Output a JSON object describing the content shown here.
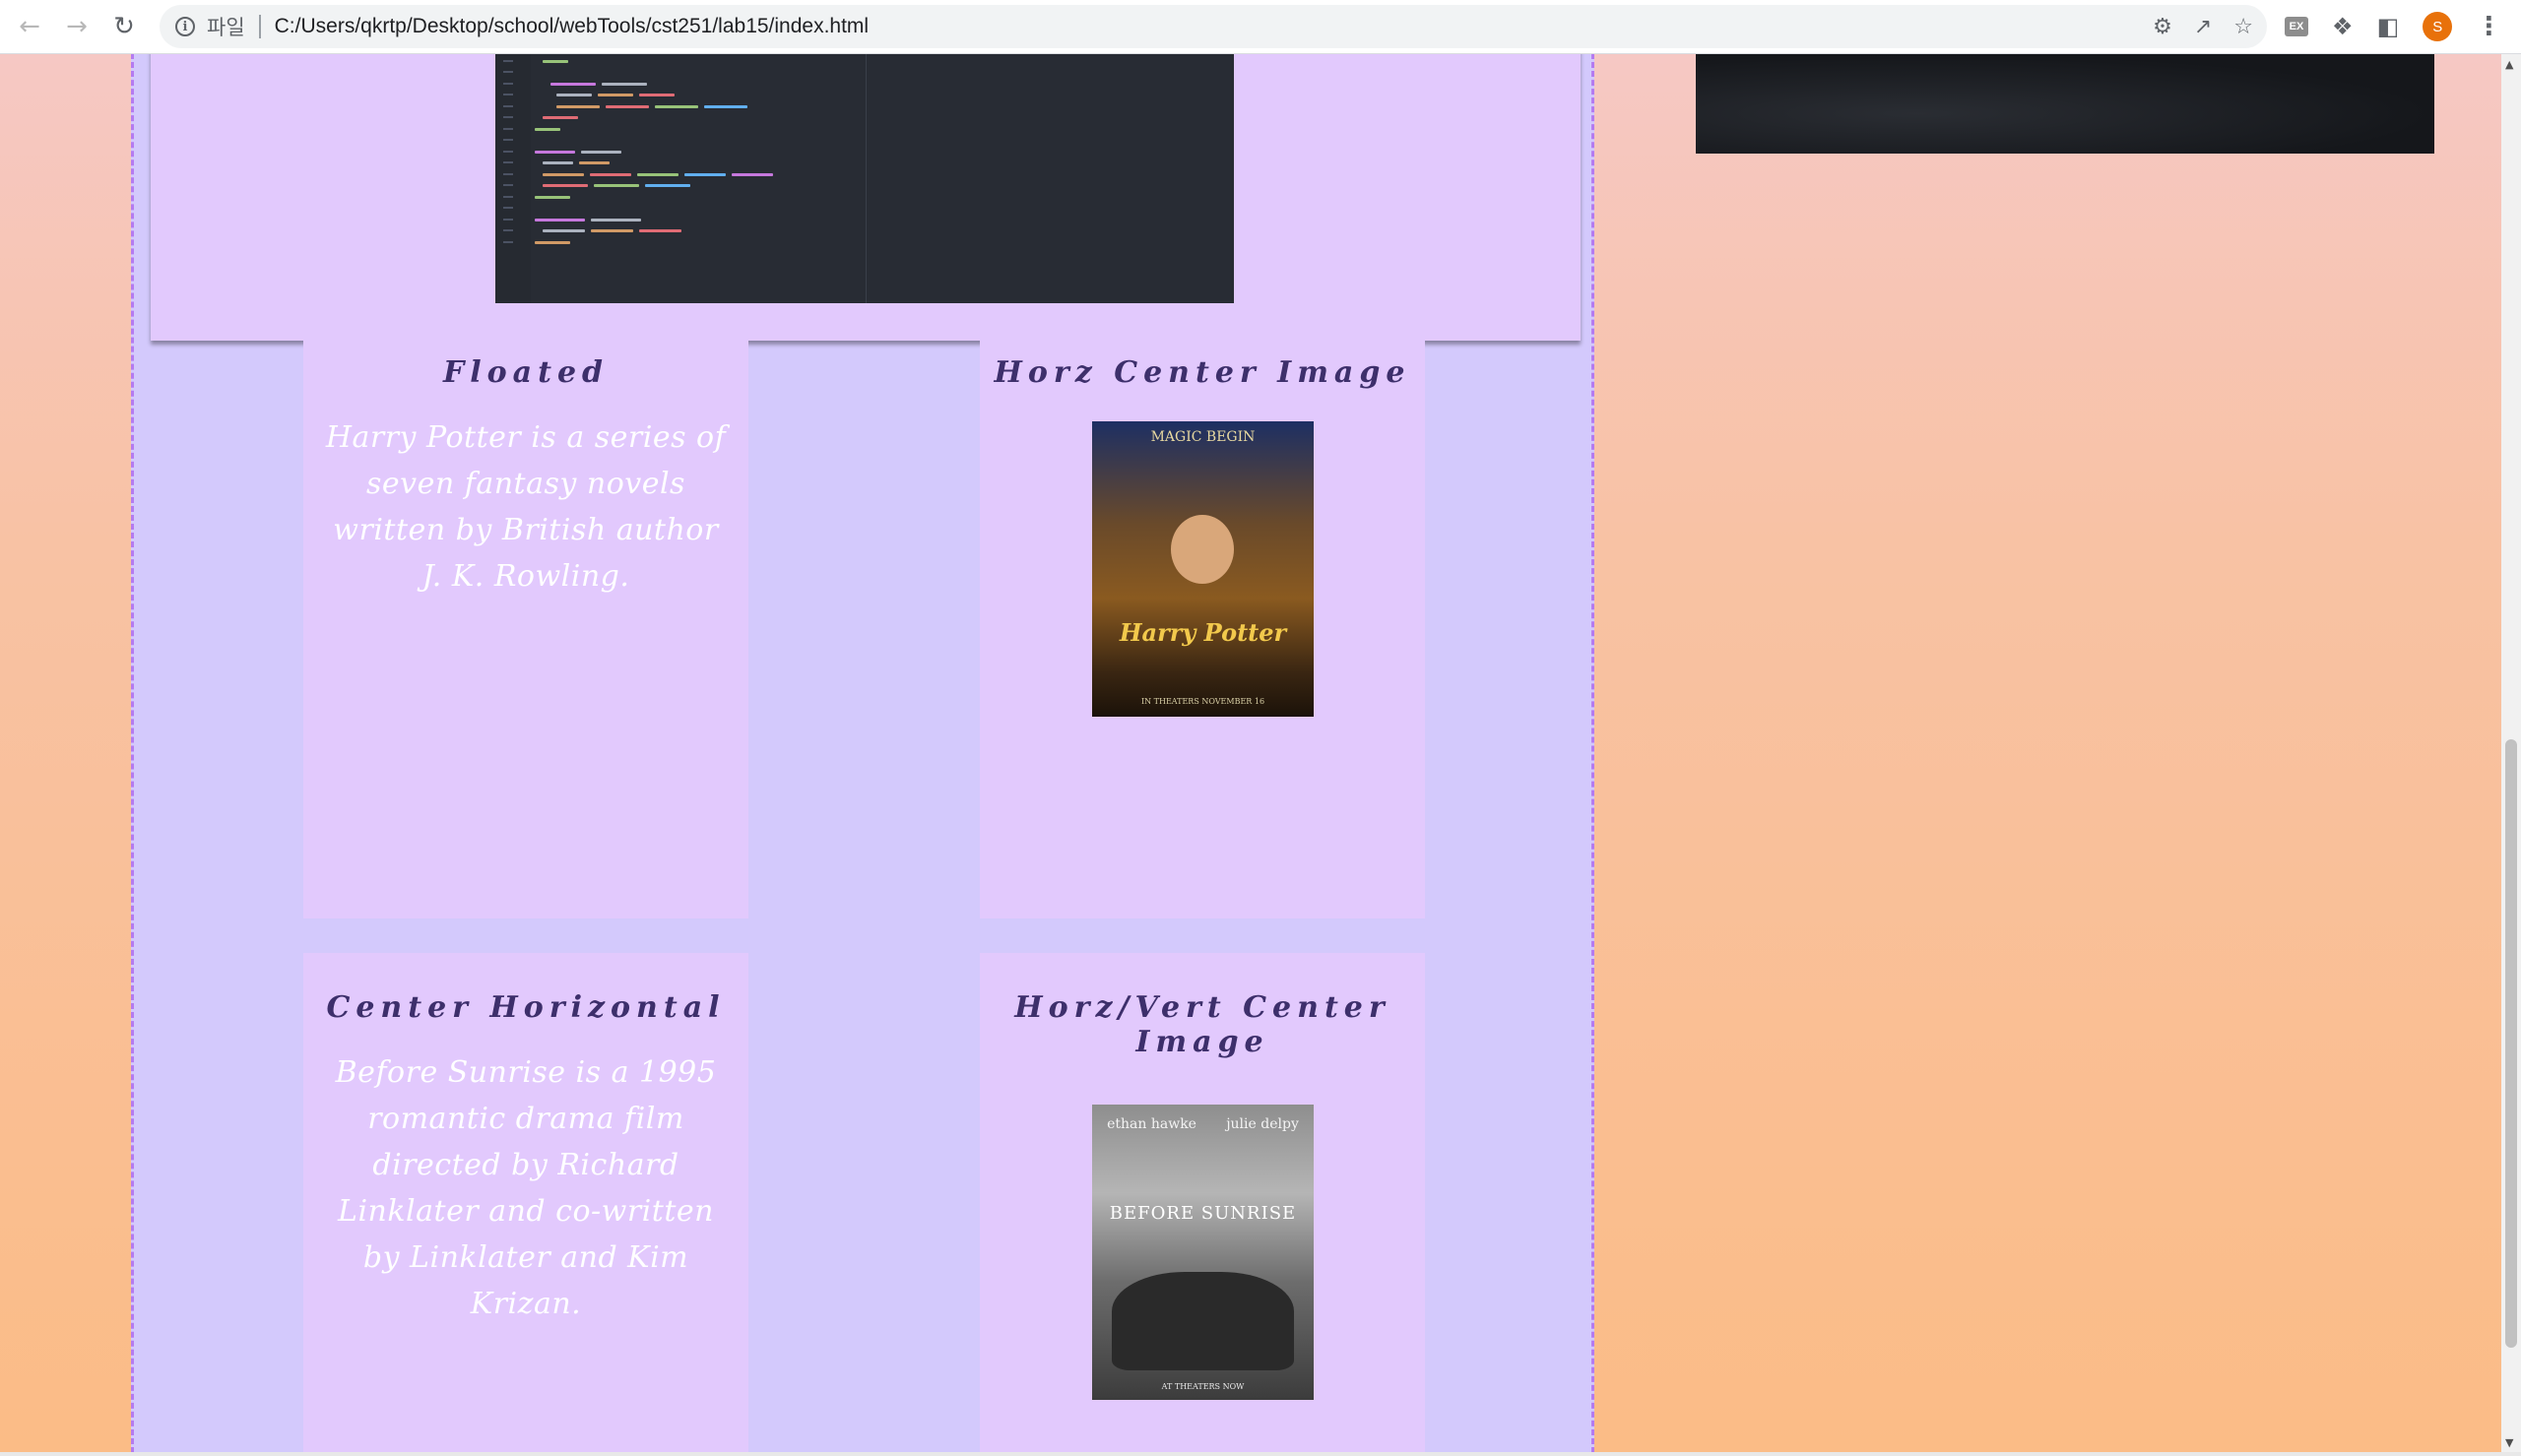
{
  "browser": {
    "scheme_label": "파일",
    "url": "C:/Users/qkrtp/Desktop/school/webTools/cst251/lab15/index.html",
    "profile_initial": "S",
    "extension_badge": "EX"
  },
  "cards": {
    "floated": {
      "title": "Floated",
      "text": "Harry Potter is a series of seven fantasy novels written by British author J. K. Rowling."
    },
    "horz_center_image": {
      "title": "Horz Center Image"
    },
    "center_horizontal": {
      "title": "Center Horizontal",
      "text": "Before Sunrise is a 1995 romantic drama film directed by Richard Linklater and co-written by Linklater and Kim Krizan."
    },
    "horz_vert_center_image": {
      "title": "Horz/Vert Center Image"
    }
  },
  "posters": {
    "harry_potter": {
      "top_text": "MAGIC BEGIN",
      "logo_text": "Harry Potter",
      "bottom_text": "IN THEATERS NOVEMBER 16"
    },
    "before_sunrise": {
      "actors": [
        "ethan hawke",
        "julie delpy"
      ],
      "logo_text": "BEFORE SUNRISE",
      "bottom_text": "AT THEATERS NOW"
    }
  },
  "colors": {
    "main_column": "#d3c9fc",
    "card": "#e2c9fd",
    "dashed_border": "#b47bf0",
    "title_text": "#3d2f6b",
    "body_text": "#ffffff",
    "avatar": "#e8710a"
  }
}
